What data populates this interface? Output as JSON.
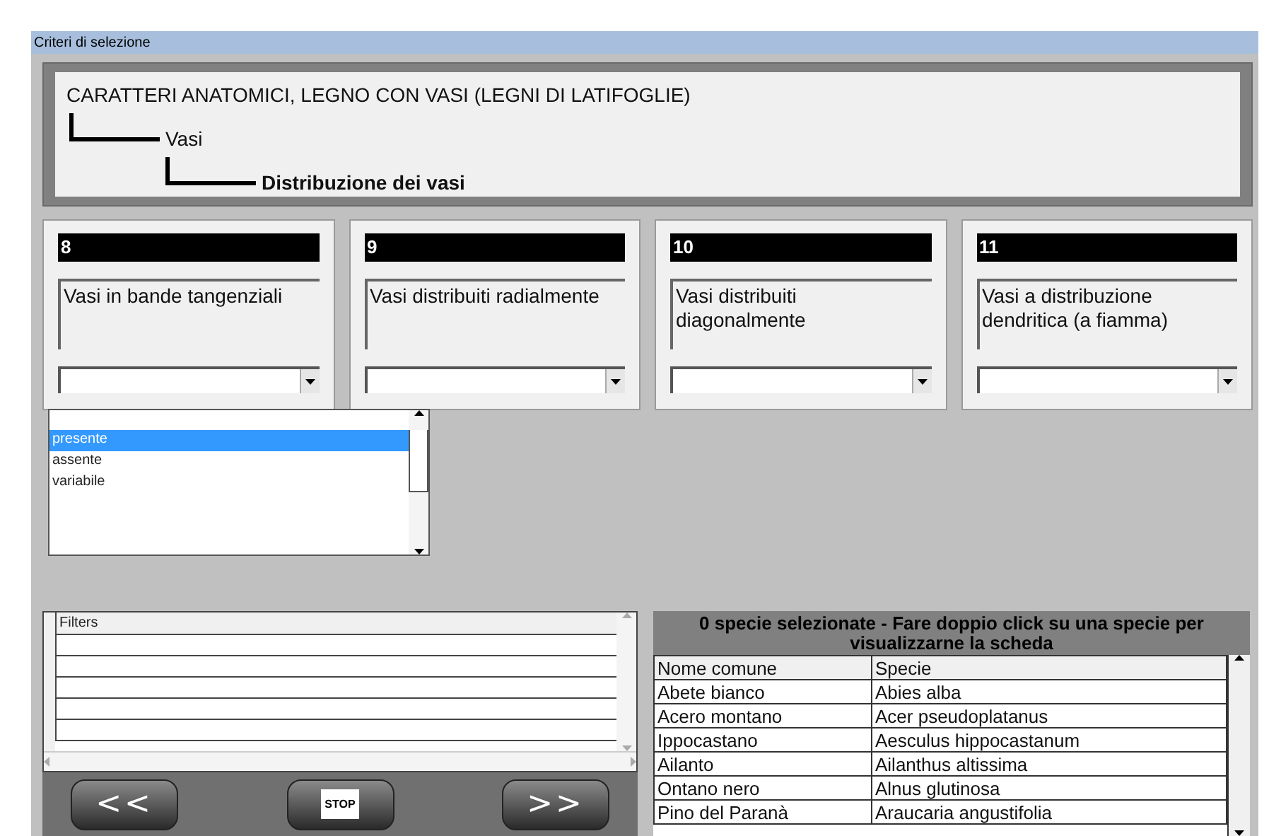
{
  "window": {
    "title": "Criteri di selezione"
  },
  "breadcrumb": {
    "root": "CARATTERI ANATOMICI, LEGNO CON VASI (LEGNI DI LATIFOGLIE)",
    "level_1": "Vasi",
    "level_2": "Distribuzione dei vasi"
  },
  "criteria": [
    {
      "number": "8",
      "label": "Vasi in bande tangenziali"
    },
    {
      "number": "9",
      "label": "Vasi distribuiti radialmente"
    },
    {
      "number": "10",
      "label": "Vasi distribuiti diagonalmente"
    },
    {
      "number": "11",
      "label": "Vasi a distribuzione dendritica (a fiamma)"
    }
  ],
  "dropdown_options": [
    {
      "label": "presente",
      "selected": true
    },
    {
      "label": "assente",
      "selected": false
    },
    {
      "label": "variabile",
      "selected": false
    }
  ],
  "filters": {
    "header": "Filters"
  },
  "buttons": [
    {
      "kind": "back",
      "label": "<<"
    },
    {
      "kind": "stop",
      "label": "STOP"
    },
    {
      "kind": "forward",
      "label": ">>"
    }
  ],
  "species": {
    "caption": "0 specie selezionate - Fare doppio click su una specie per visualizzarne la scheda",
    "columns": [
      "Nome comune",
      "Specie"
    ],
    "rows": [
      [
        "Abete bianco",
        "Abies alba"
      ],
      [
        "Acero montano",
        "Acer pseudoplatanus"
      ],
      [
        "Ippocastano",
        "Aesculus hippocastanum"
      ],
      [
        "Ailanto",
        "Ailanthus altissima"
      ],
      [
        "Ontano nero",
        "Alnus glutinosa"
      ],
      [
        "Pino del Paranà",
        "Araucaria angustifolia"
      ]
    ]
  }
}
